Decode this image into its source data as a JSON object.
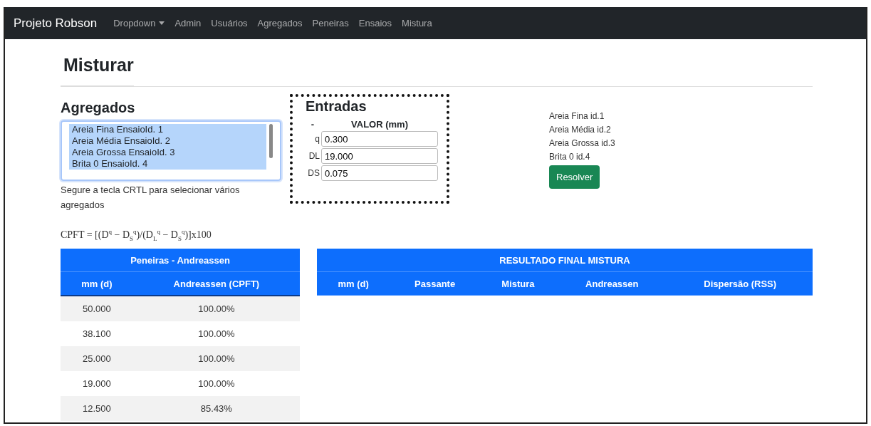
{
  "navbar": {
    "brand": "Projeto Robson",
    "items": [
      {
        "label": "Dropdown",
        "kind": "dropdown"
      },
      {
        "label": "Admin",
        "kind": "link"
      },
      {
        "label": "Usuários",
        "kind": "link"
      },
      {
        "label": "Agregados",
        "kind": "link"
      },
      {
        "label": "Peneiras",
        "kind": "link"
      },
      {
        "label": "Ensaios",
        "kind": "link"
      },
      {
        "label": "Mistura",
        "kind": "link"
      }
    ]
  },
  "page_title": "Misturar",
  "agregados": {
    "title": "Agregados",
    "options": [
      {
        "label": "Areia Fina EnsaioId. 1",
        "selected": true
      },
      {
        "label": "Areia Média EnsaioId. 2",
        "selected": true
      },
      {
        "label": "Areia Grossa EnsaioId. 3",
        "selected": true
      },
      {
        "label": "Brita 0 EnsaioId. 4",
        "selected": true
      }
    ],
    "help": "Segure a tecla CRTL para selecionar vários agregados"
  },
  "entradas": {
    "title": "Entradas",
    "columns": [
      "-",
      "VALOR (mm)"
    ],
    "rows": [
      {
        "label": "q",
        "value": "0.300"
      },
      {
        "label": "DL",
        "value": "19.000"
      },
      {
        "label": "DS",
        "value": "0.075"
      }
    ]
  },
  "selected_list": [
    "Areia Fina id.1",
    "Areia Média id.2",
    "Areia Grossa id.3",
    "Brita 0 id.4"
  ],
  "resolve_button": "Resolver",
  "formula": "CPFT = [(D$^{q}$ − D$_{S}$$^{q}$)/(D$_{L}$$^{q}$ − D$_{S}$$^{q}$)]x100",
  "peneiras_table": {
    "title": "Peneiras - Andreassen",
    "columns": [
      "mm (d)",
      "Andreassen (CPFT)"
    ],
    "rows": [
      [
        "50.000",
        "100.00%"
      ],
      [
        "38.100",
        "100.00%"
      ],
      [
        "25.000",
        "100.00%"
      ],
      [
        "19.000",
        "100.00%"
      ],
      [
        "12.500",
        "85.43%"
      ]
    ]
  },
  "result_table": {
    "title": "RESULTADO FINAL MISTURA",
    "columns": [
      "mm (d)",
      "Passante",
      "Mistura",
      "Andreassen",
      "Dispersão (RSS)"
    ]
  }
}
